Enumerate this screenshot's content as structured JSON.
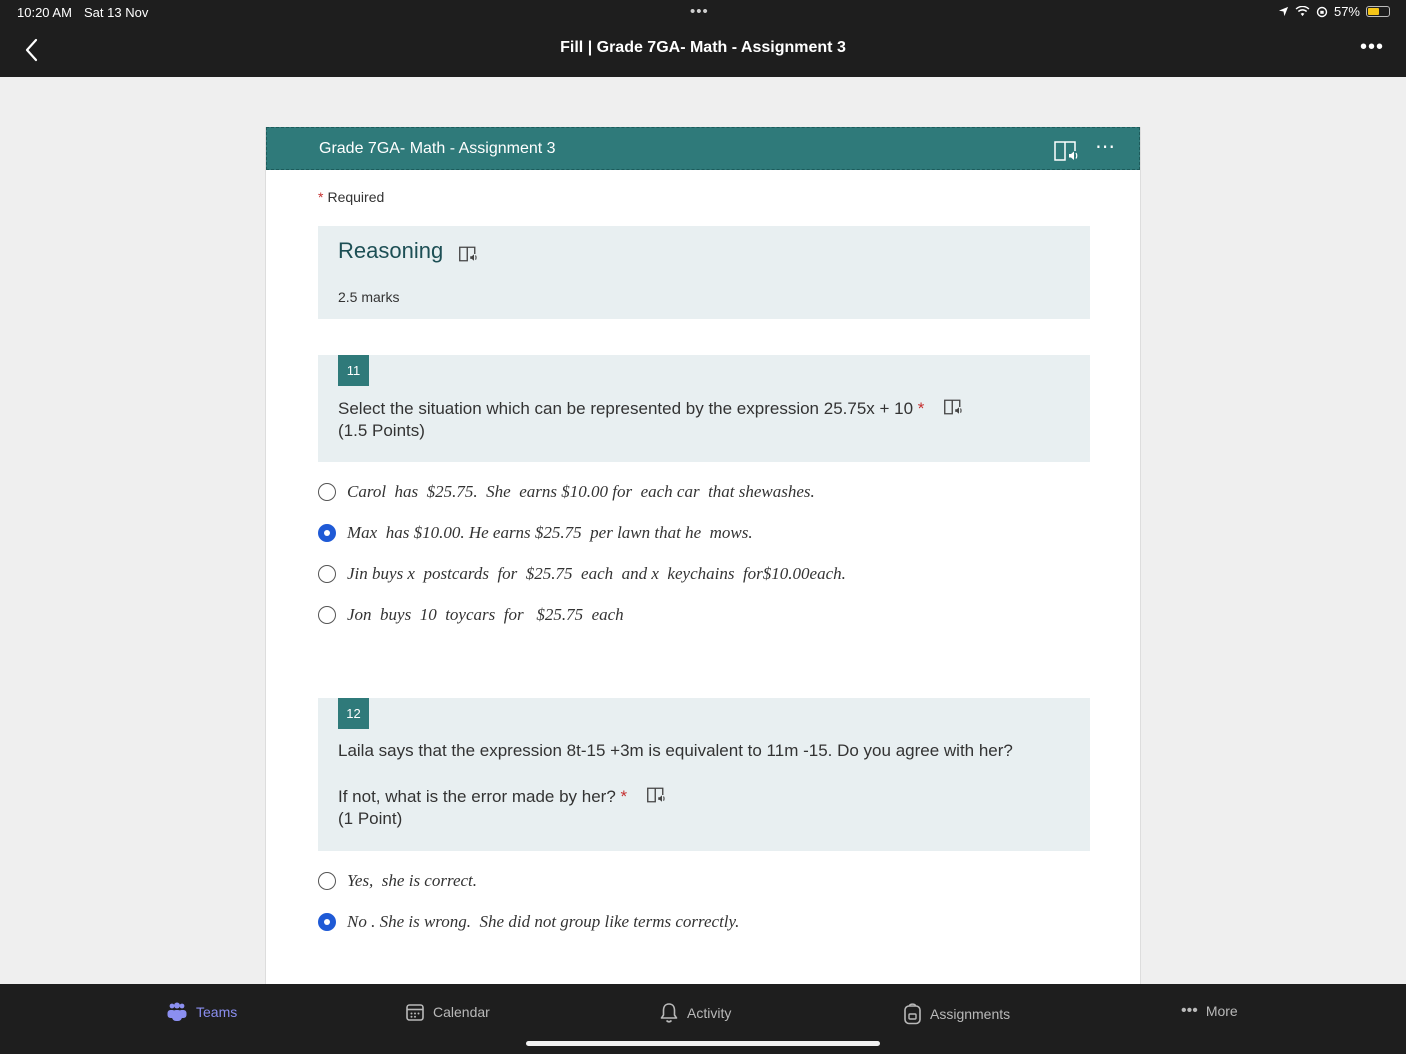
{
  "status": {
    "time": "10:20 AM",
    "date": "Sat 13 Nov",
    "battery": "57%",
    "battery_level": 0.57
  },
  "app": {
    "title": "Fill | Grade 7GA- Math - Assignment 3"
  },
  "form": {
    "header_title": "Grade 7GA- Math - Assignment 3",
    "required_label": "Required",
    "section": {
      "title": "Reasoning",
      "subtitle": "2.5 marks"
    },
    "questions": [
      {
        "number": "11",
        "text": "Select  the situation  which can be represented by the expression 25.75x + 10",
        "points": "(1.5 Points)",
        "options": [
          {
            "label": "Carol  has  $25.75.  She  earns $10.00 for  each car  that shewashes.",
            "selected": false
          },
          {
            "label": "Max  has $10.00. He earns $25.75  per lawn that he  mows.",
            "selected": true
          },
          {
            "label": "Jin buys x  postcards  for  $25.75  each  and x  keychains  for$10.00each.",
            "selected": false
          },
          {
            "label": "Jon  buys  10  toycars  for   $25.75  each",
            "selected": false
          }
        ]
      },
      {
        "number": "12",
        "text": "Laila  says that the expression  8t-15 +3m   is equivalent to  11m -15. Do you agree with her?",
        "text2": "If not, what is the error made by her?",
        "points": "(1 Point)",
        "options": [
          {
            "label": "Yes,  she is correct.",
            "selected": false
          },
          {
            "label": "No . She is wrong.  She did not group like terms correctly.",
            "selected": true
          }
        ]
      }
    ]
  },
  "tabs": [
    {
      "label": "Teams",
      "icon": "teams-icon",
      "active": true
    },
    {
      "label": "Calendar",
      "icon": "calendar-icon",
      "active": false
    },
    {
      "label": "Activity",
      "icon": "bell-icon",
      "active": false
    },
    {
      "label": "Assignments",
      "icon": "backpack-icon",
      "active": false
    },
    {
      "label": "More",
      "icon": "ellipsis-icon",
      "active": false
    }
  ],
  "colors": {
    "accent": "#2f7a7a",
    "radio_selected": "#1f5ad6",
    "tab_active": "#8b8ff0"
  }
}
